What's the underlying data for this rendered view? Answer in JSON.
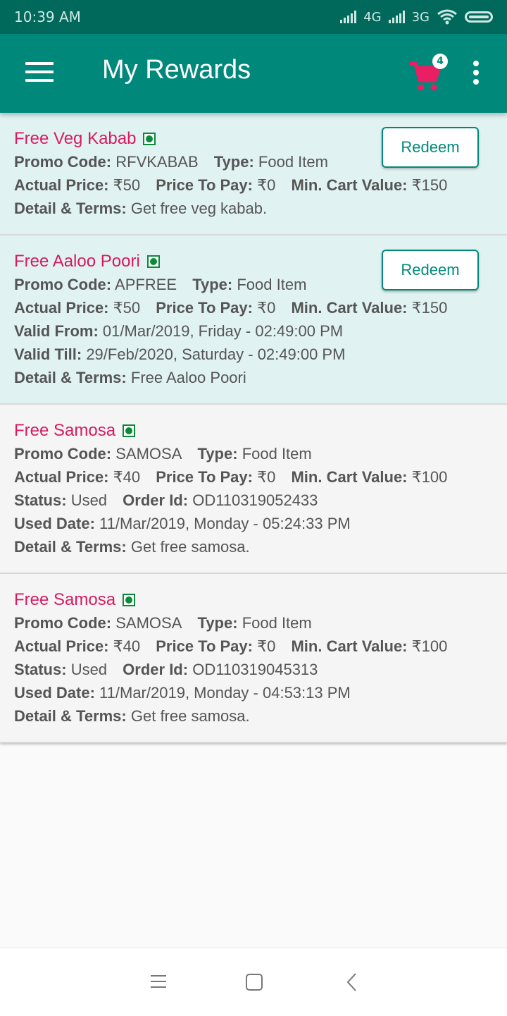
{
  "status_bar": {
    "time": "10:39 AM",
    "network_1": "4G",
    "network_2": "3G"
  },
  "app_bar": {
    "title": "My Rewards",
    "cart_count": "4"
  },
  "labels": {
    "promo_code": "Promo Code:",
    "type": "Type:",
    "actual_price": "Actual Price:",
    "price_to_pay": "Price To Pay:",
    "min_cart_value": "Min. Cart Value:",
    "detail_terms": "Detail & Terms:",
    "valid_from": "Valid From:",
    "valid_till": "Valid Till:",
    "status": "Status:",
    "order_id": "Order Id:",
    "used_date": "Used Date:",
    "redeem": "Redeem"
  },
  "rewards": [
    {
      "title": "Free Veg Kabab",
      "promo_code": "RFVKABAB",
      "type": "Food Item",
      "actual_price": "₹50",
      "price_to_pay": "₹0",
      "min_cart_value": "₹150",
      "detail": "Get free veg kabab."
    },
    {
      "title": "Free Aaloo Poori",
      "promo_code": "APFREE",
      "type": "Food Item",
      "actual_price": "₹50",
      "price_to_pay": "₹0",
      "min_cart_value": "₹150",
      "valid_from": "01/Mar/2019, Friday - 02:49:00 PM",
      "valid_till": "29/Feb/2020, Saturday - 02:49:00 PM",
      "detail": "Free Aaloo Poori"
    },
    {
      "title": "Free Samosa",
      "promo_code": "SAMOSA",
      "type": "Food Item",
      "actual_price": "₹40",
      "price_to_pay": "₹0",
      "min_cart_value": "₹100",
      "status": "Used",
      "order_id": "OD110319052433",
      "used_date": "11/Mar/2019, Monday - 05:24:33 PM",
      "detail": "Get free samosa."
    },
    {
      "title": "Free Samosa",
      "promo_code": "SAMOSA",
      "type": "Food Item",
      "actual_price": "₹40",
      "price_to_pay": "₹0",
      "min_cart_value": "₹100",
      "status": "Used",
      "order_id": "OD110319045313",
      "used_date": "11/Mar/2019, Monday - 04:53:13 PM",
      "detail": "Get free samosa."
    }
  ],
  "colors": {
    "status_bar": "#00695c",
    "app_bar": "#00897b",
    "reward_title": "#d81b60",
    "available_card": "#e0f2f1",
    "used_card": "#f5f5f5",
    "veg_mark": "#0b8a3a"
  },
  "icons": {
    "menu": "hamburger-menu-icon",
    "cart": "shopping-cart-icon",
    "overflow": "more-vert-icon",
    "veg": "veg-indicator-icon"
  }
}
